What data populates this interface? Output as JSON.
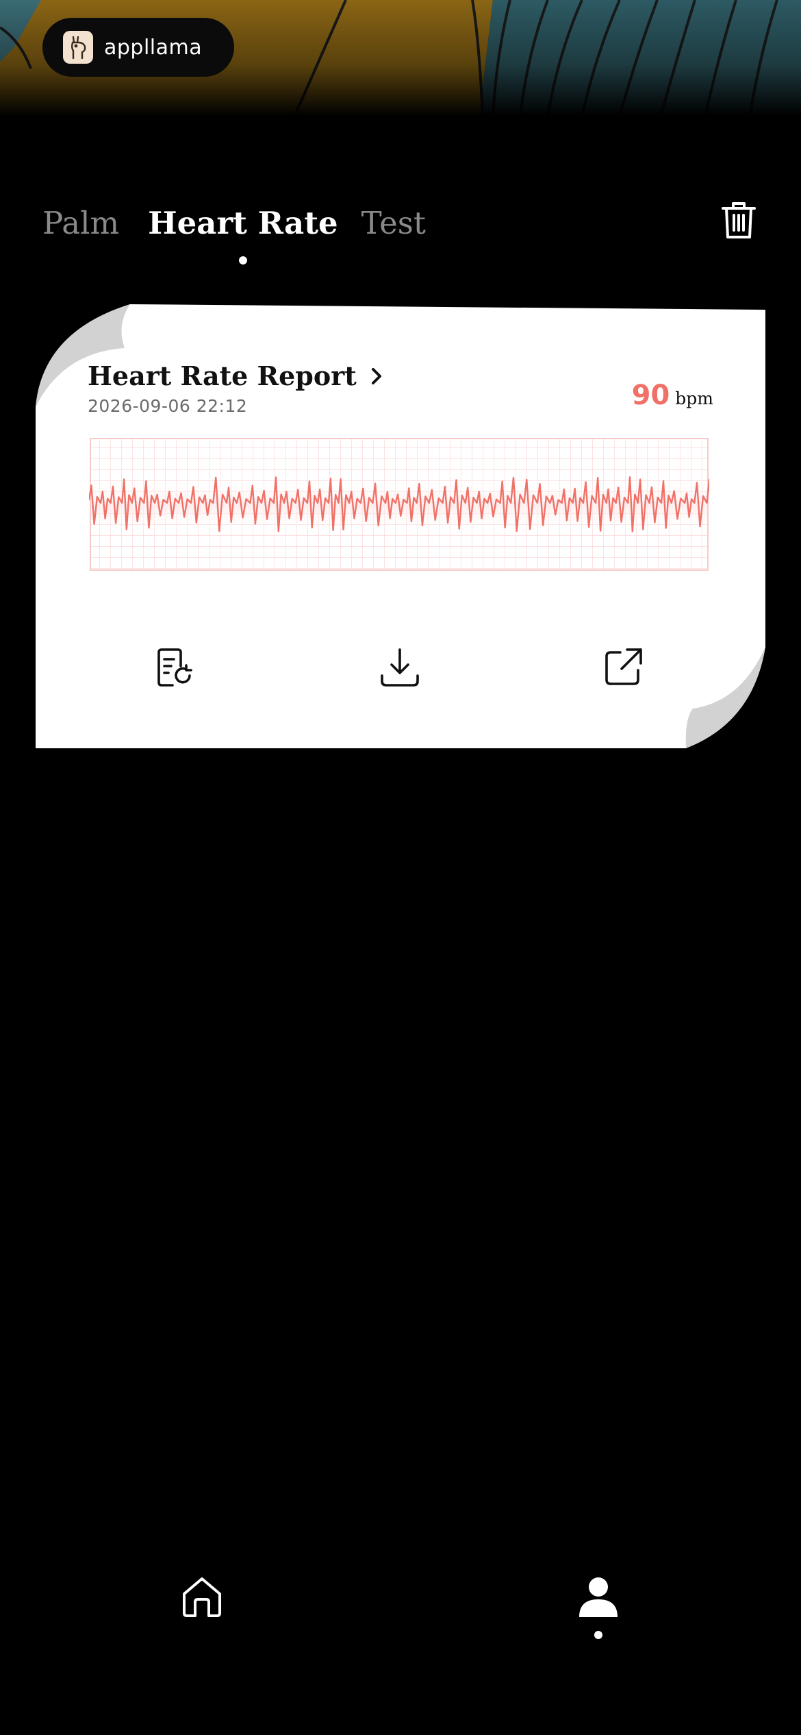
{
  "brand": {
    "name": "appllama",
    "logo_icon": "llama-logo-icon"
  },
  "tabs": [
    {
      "label": "Palm",
      "active": false
    },
    {
      "label": "Heart Rate",
      "active": true
    },
    {
      "label": "Test",
      "active": false
    }
  ],
  "toolbar": {
    "delete_icon": "trash-icon"
  },
  "report": {
    "title": "Heart Rate Report",
    "date": "2026-09-06 22:12",
    "bpm_value": "90",
    "bpm_unit": "bpm",
    "actions": [
      "report-refresh-icon",
      "download-icon",
      "share-icon"
    ]
  },
  "nav": {
    "items": [
      {
        "name": "home",
        "icon": "home-icon",
        "active": false
      },
      {
        "name": "profile",
        "icon": "person-icon",
        "active": true
      }
    ]
  },
  "colors": {
    "background": "#000000",
    "accent": "#f07167",
    "card": "#ffffff",
    "ecg_grid": "#fbd9d9"
  }
}
